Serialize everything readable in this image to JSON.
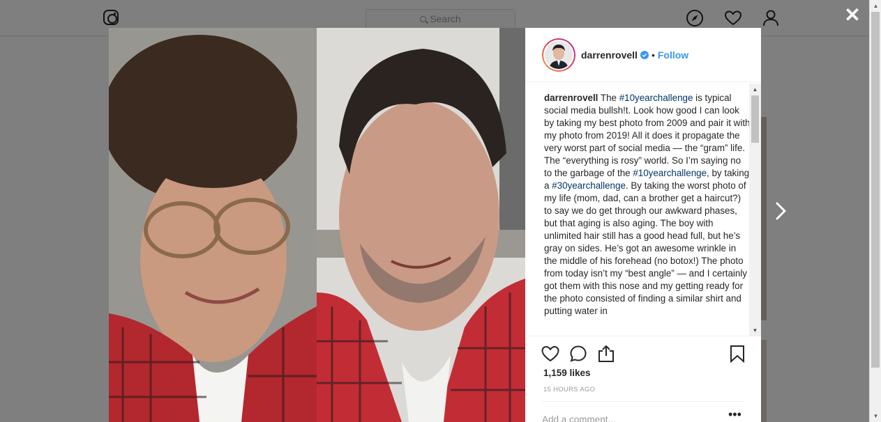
{
  "header": {
    "search_placeholder": "Search",
    "icons": [
      "instagram-logo-icon",
      "explore-compass-icon",
      "activity-heart-icon",
      "profile-person-icon"
    ]
  },
  "modal": {
    "author": {
      "username": "darrenrovell",
      "verified": true,
      "separator": "•",
      "follow_label": "Follow"
    },
    "caption": {
      "username": "darrenrovell",
      "segments": [
        {
          "text": " The ",
          "tag": false
        },
        {
          "text": "#10yearchallenge",
          "tag": true
        },
        {
          "text": " is typical social media bullsh!t. Look how good I can look by taking my best photo from 2009 and pair it with my photo from 2019! All it does it propagate the very worst part of social media — the “gram” life. The “everything is rosy” world. So I’m saying no to the garbage of the ",
          "tag": false
        },
        {
          "text": "#10yearchallenge",
          "tag": true
        },
        {
          "text": ", by taking a ",
          "tag": false
        },
        {
          "text": "#30yearchallenge",
          "tag": true
        },
        {
          "text": ". By taking the worst photo of my life (mom, dad, can a brother get a haircut?) to say we do get through our awkward phases, but that aging is also aging. The boy with unlimited hair still has a good head full, but he’s gray on sides. He’s got an awesome wrinkle in the middle of his forehead (no botox!) The photo from today isn’t my “best angle” — and I certainly got them with this nose and my getting ready for the photo consisted of finding a similar shirt and putting water in",
          "tag": false
        }
      ]
    },
    "likes": "1,159 likes",
    "timestamp": "15 HOURS AGO",
    "comment_placeholder": "Add a comment...",
    "more_options": "•••"
  },
  "colors": {
    "accent": "#3897f0",
    "hashtag": "#003569",
    "overlay": "rgba(0,0,0,0.5)"
  }
}
